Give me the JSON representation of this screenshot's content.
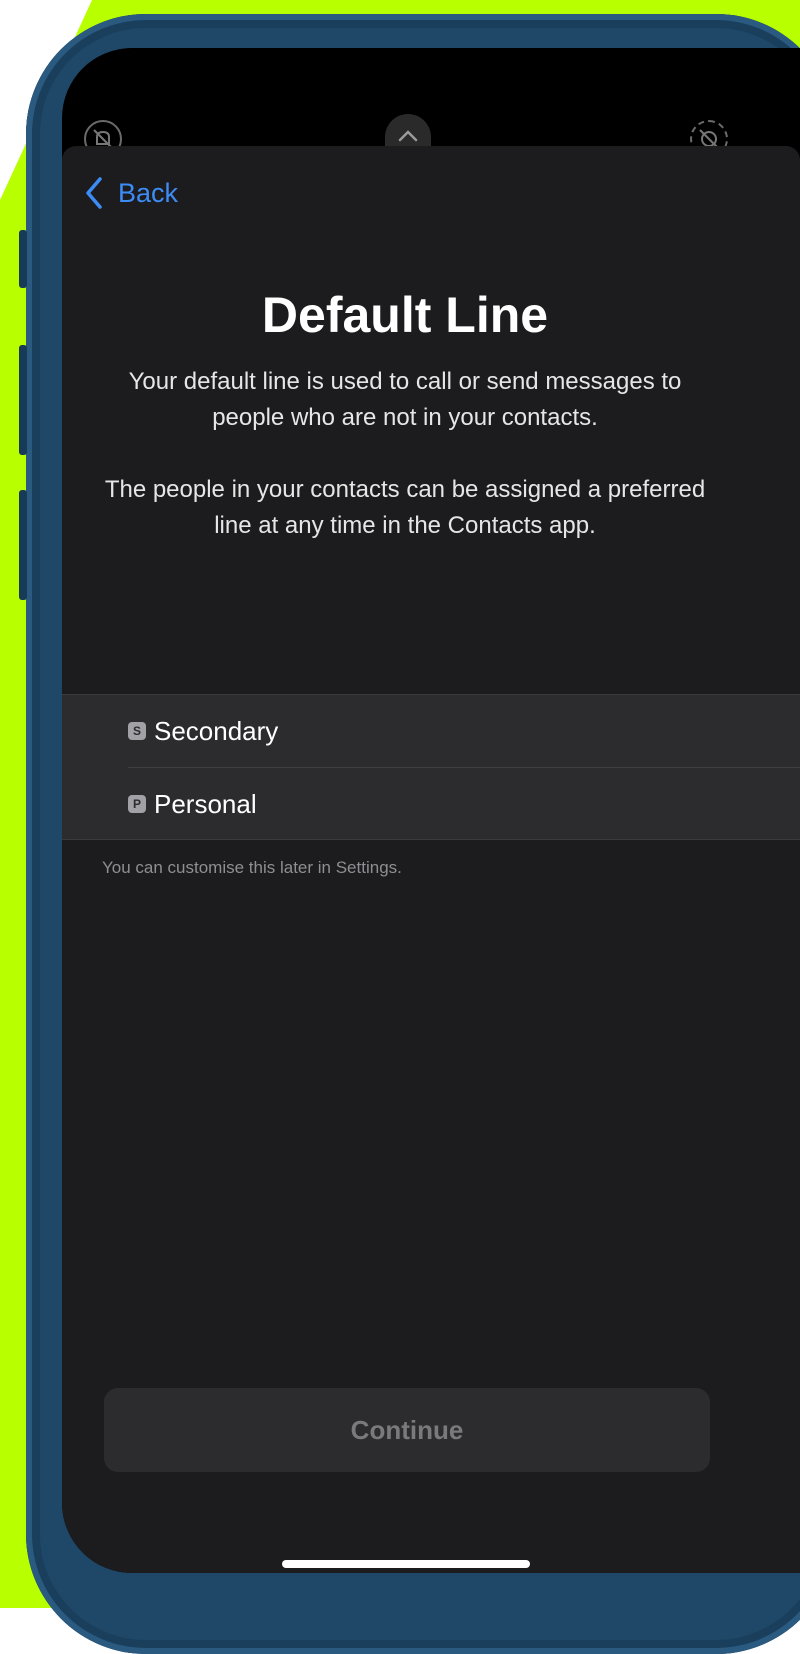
{
  "colors": {
    "accent_background": "#b8ff00",
    "phone_case": "#1f4868",
    "link_blue": "#3d8cf5",
    "sheet_background": "#1c1c1e"
  },
  "status_bar": {
    "left_icon": "muted-bell-icon",
    "center_icon": "chevron-up-icon",
    "right_icon": "do-not-disturb-icon"
  },
  "nav": {
    "back_label": "Back",
    "back_icon": "chevron-left-icon"
  },
  "header": {
    "title": "Default Line",
    "description_1": "Your default line is used to call or send messages to people who are not in your contacts.",
    "description_2": "The people in your contacts can be assigned a preferred line at any time in the Contacts app."
  },
  "lines": [
    {
      "badge": "S",
      "label": "Secondary"
    },
    {
      "badge": "P",
      "label": "Personal"
    }
  ],
  "footnote": "You can customise this later in Settings.",
  "continue_label": "Continue"
}
